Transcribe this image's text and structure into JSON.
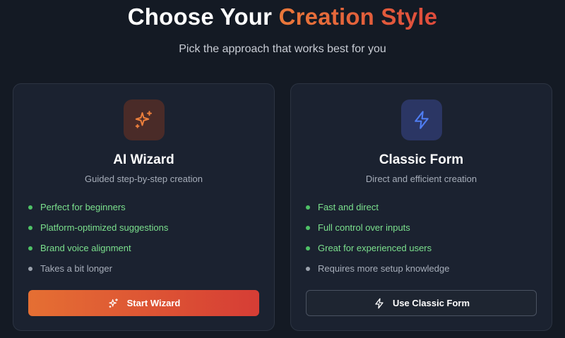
{
  "header": {
    "title_prefix": "Choose Your ",
    "title_accent": "Creation Style",
    "subtitle": "Pick the approach that works best for you"
  },
  "cards": [
    {
      "icon": "sparkles-icon",
      "title": "AI Wizard",
      "description": "Guided step-by-step creation",
      "features": [
        {
          "text": "Perfect for beginners",
          "tone": "positive"
        },
        {
          "text": "Platform-optimized suggestions",
          "tone": "positive"
        },
        {
          "text": "Brand voice alignment",
          "tone": "positive"
        },
        {
          "text": "Takes a bit longer",
          "tone": "neutral"
        }
      ],
      "button_label": "Start Wizard",
      "button_icon": "sparkles-icon"
    },
    {
      "icon": "lightning-bolt-icon",
      "title": "Classic Form",
      "description": "Direct and efficient creation",
      "features": [
        {
          "text": "Fast and direct",
          "tone": "positive"
        },
        {
          "text": "Full control over inputs",
          "tone": "positive"
        },
        {
          "text": "Great for experienced users",
          "tone": "positive"
        },
        {
          "text": "Requires more setup knowledge",
          "tone": "neutral"
        }
      ],
      "button_label": "Use Classic Form",
      "button_icon": "lightning-bolt-icon"
    }
  ],
  "colors": {
    "background": "#141a24",
    "card": "#1b2230",
    "accent_orange": "#e9783a",
    "accent_red": "#df4b3c",
    "positive": "#7be08d",
    "bolt_blue": "#4f7df2"
  }
}
